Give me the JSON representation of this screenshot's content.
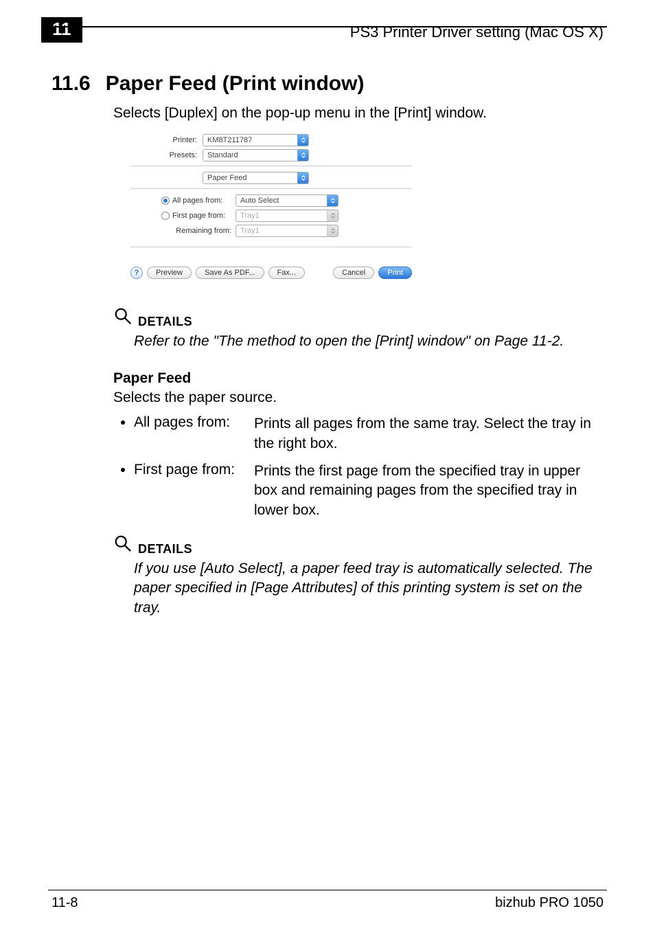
{
  "header": {
    "chapter": "11",
    "title_right": "PS3 Printer Driver setting (Mac OS X)"
  },
  "section": {
    "number": "11.6",
    "title": "Paper Feed (Print window)",
    "lead": "Selects [Duplex] on the pop-up menu in the [Print] window."
  },
  "dialog": {
    "printer_label": "Printer:",
    "printer_value": "KM8T211787",
    "presets_label": "Presets:",
    "presets_value": "Standard",
    "panel_value": "Paper Feed",
    "all_pages_label": "All pages from:",
    "all_pages_value": "Auto Select",
    "first_page_label": "First page from:",
    "first_page_value": "Tray1",
    "remaining_label": "Remaining from:",
    "remaining_value": "Tray1",
    "help": "?",
    "preview": "Preview",
    "save_pdf": "Save As PDF...",
    "fax": "Fax...",
    "cancel": "Cancel",
    "print": "Print"
  },
  "details1": {
    "label": "DETAILS",
    "body": "Refer to the \"The method to open the [Print] window\" on Page 11-2."
  },
  "paperfeed": {
    "heading": "Paper Feed",
    "desc": "Selects the paper source.",
    "items": [
      {
        "term": "All pages from:",
        "def": "Prints all pages from the same tray. Select the tray in the right box."
      },
      {
        "term": "First page from:",
        "def": "Prints the first page from the specified tray in upper box and remaining pages from the specified tray in lower box."
      }
    ]
  },
  "details2": {
    "label": "DETAILS",
    "body": "If you use [Auto Select], a paper feed tray is automatically selected. The paper specified in [Page Attributes] of this printing system is set on the tray."
  },
  "footer": {
    "left": "11-8",
    "right": "bizhub PRO 1050"
  }
}
